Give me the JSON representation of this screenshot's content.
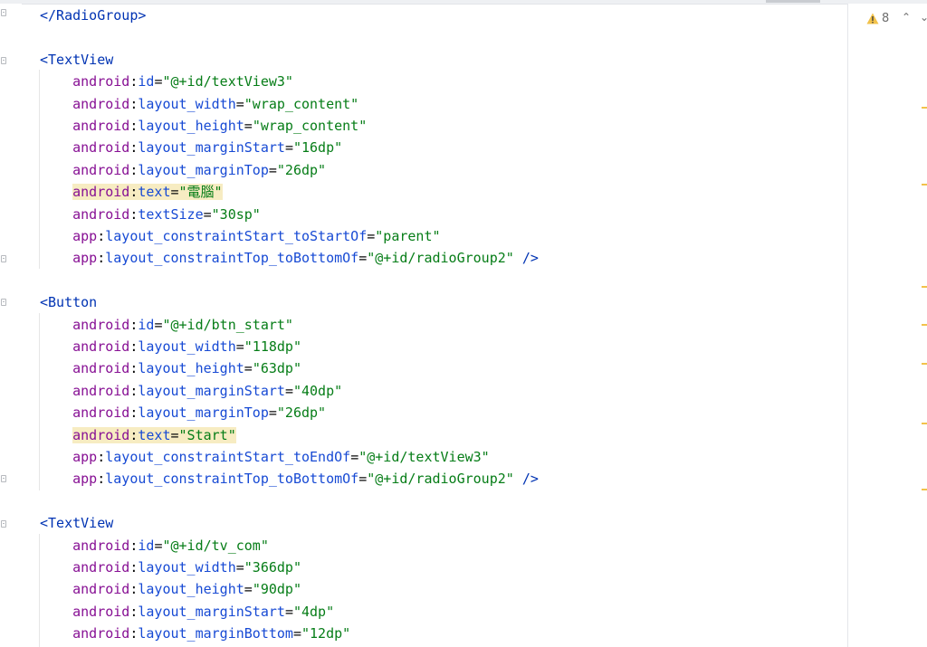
{
  "editor": {
    "lines": [
      {
        "indent": "",
        "parts": [
          [
            "tag",
            "</RadioGroup>"
          ]
        ]
      },
      {
        "indent": "",
        "parts": []
      },
      {
        "indent": "",
        "parts": [
          [
            "tag",
            "<TextView"
          ]
        ]
      },
      {
        "indent": "    ",
        "parts": [
          [
            "ns",
            "android"
          ],
          [
            "plain",
            ":"
          ],
          [
            "attr",
            "id"
          ],
          [
            "plain",
            "="
          ],
          [
            "val",
            "\"@+id/textView3\""
          ]
        ]
      },
      {
        "indent": "    ",
        "parts": [
          [
            "ns",
            "android"
          ],
          [
            "plain",
            ":"
          ],
          [
            "attr",
            "layout_width"
          ],
          [
            "plain",
            "="
          ],
          [
            "val",
            "\"wrap_content\""
          ]
        ]
      },
      {
        "indent": "    ",
        "parts": [
          [
            "ns",
            "android"
          ],
          [
            "plain",
            ":"
          ],
          [
            "attr",
            "layout_height"
          ],
          [
            "plain",
            "="
          ],
          [
            "val",
            "\"wrap_content\""
          ]
        ]
      },
      {
        "indent": "    ",
        "parts": [
          [
            "ns",
            "android"
          ],
          [
            "plain",
            ":"
          ],
          [
            "attr",
            "layout_marginStart"
          ],
          [
            "plain",
            "="
          ],
          [
            "val",
            "\"16dp\""
          ]
        ]
      },
      {
        "indent": "    ",
        "parts": [
          [
            "ns",
            "android"
          ],
          [
            "plain",
            ":"
          ],
          [
            "attr",
            "layout_marginTop"
          ],
          [
            "plain",
            "="
          ],
          [
            "val",
            "\"26dp\""
          ]
        ]
      },
      {
        "indent": "    ",
        "highlight": true,
        "parts": [
          [
            "ns",
            "android"
          ],
          [
            "plain",
            ":"
          ],
          [
            "attr",
            "text"
          ],
          [
            "plain",
            "="
          ],
          [
            "val",
            "\"電腦\""
          ]
        ]
      },
      {
        "indent": "    ",
        "parts": [
          [
            "ns",
            "android"
          ],
          [
            "plain",
            ":"
          ],
          [
            "attr",
            "textSize"
          ],
          [
            "plain",
            "="
          ],
          [
            "val",
            "\"30sp\""
          ]
        ]
      },
      {
        "indent": "    ",
        "parts": [
          [
            "ns",
            "app"
          ],
          [
            "plain",
            ":"
          ],
          [
            "attr",
            "layout_constraintStart_toStartOf"
          ],
          [
            "plain",
            "="
          ],
          [
            "val",
            "\"parent\""
          ]
        ]
      },
      {
        "indent": "    ",
        "parts": [
          [
            "ns",
            "app"
          ],
          [
            "plain",
            ":"
          ],
          [
            "attr",
            "layout_constraintTop_toBottomOf"
          ],
          [
            "plain",
            "="
          ],
          [
            "val",
            "\"@+id/radioGroup2\""
          ],
          [
            "plain",
            " "
          ],
          [
            "tag",
            "/>"
          ]
        ]
      },
      {
        "indent": "",
        "parts": []
      },
      {
        "indent": "",
        "parts": [
          [
            "tag",
            "<Button"
          ]
        ]
      },
      {
        "indent": "    ",
        "parts": [
          [
            "ns",
            "android"
          ],
          [
            "plain",
            ":"
          ],
          [
            "attr",
            "id"
          ],
          [
            "plain",
            "="
          ],
          [
            "val",
            "\"@+id/btn_start\""
          ]
        ]
      },
      {
        "indent": "    ",
        "parts": [
          [
            "ns",
            "android"
          ],
          [
            "plain",
            ":"
          ],
          [
            "attr",
            "layout_width"
          ],
          [
            "plain",
            "="
          ],
          [
            "val",
            "\"118dp\""
          ]
        ]
      },
      {
        "indent": "    ",
        "parts": [
          [
            "ns",
            "android"
          ],
          [
            "plain",
            ":"
          ],
          [
            "attr",
            "layout_height"
          ],
          [
            "plain",
            "="
          ],
          [
            "val",
            "\"63dp\""
          ]
        ]
      },
      {
        "indent": "    ",
        "parts": [
          [
            "ns",
            "android"
          ],
          [
            "plain",
            ":"
          ],
          [
            "attr",
            "layout_marginStart"
          ],
          [
            "plain",
            "="
          ],
          [
            "val",
            "\"40dp\""
          ]
        ]
      },
      {
        "indent": "    ",
        "parts": [
          [
            "ns",
            "android"
          ],
          [
            "plain",
            ":"
          ],
          [
            "attr",
            "layout_marginTop"
          ],
          [
            "plain",
            "="
          ],
          [
            "val",
            "\"26dp\""
          ]
        ]
      },
      {
        "indent": "    ",
        "highlight": true,
        "parts": [
          [
            "ns",
            "android"
          ],
          [
            "plain",
            ":"
          ],
          [
            "attr",
            "text"
          ],
          [
            "plain",
            "="
          ],
          [
            "val",
            "\"Start\""
          ]
        ]
      },
      {
        "indent": "    ",
        "parts": [
          [
            "ns",
            "app"
          ],
          [
            "plain",
            ":"
          ],
          [
            "attr",
            "layout_constraintStart_toEndOf"
          ],
          [
            "plain",
            "="
          ],
          [
            "val",
            "\"@+id/textView3\""
          ]
        ]
      },
      {
        "indent": "    ",
        "parts": [
          [
            "ns",
            "app"
          ],
          [
            "plain",
            ":"
          ],
          [
            "attr",
            "layout_constraintTop_toBottomOf"
          ],
          [
            "plain",
            "="
          ],
          [
            "val",
            "\"@+id/radioGroup2\""
          ],
          [
            "plain",
            " "
          ],
          [
            "tag",
            "/>"
          ]
        ]
      },
      {
        "indent": "",
        "parts": []
      },
      {
        "indent": "",
        "parts": [
          [
            "tag",
            "<TextView"
          ]
        ]
      },
      {
        "indent": "    ",
        "parts": [
          [
            "ns",
            "android"
          ],
          [
            "plain",
            ":"
          ],
          [
            "attr",
            "id"
          ],
          [
            "plain",
            "="
          ],
          [
            "val",
            "\"@+id/tv_com\""
          ]
        ]
      },
      {
        "indent": "    ",
        "parts": [
          [
            "ns",
            "android"
          ],
          [
            "plain",
            ":"
          ],
          [
            "attr",
            "layout_width"
          ],
          [
            "plain",
            "="
          ],
          [
            "val",
            "\"366dp\""
          ]
        ]
      },
      {
        "indent": "    ",
        "parts": [
          [
            "ns",
            "android"
          ],
          [
            "plain",
            ":"
          ],
          [
            "attr",
            "layout_height"
          ],
          [
            "plain",
            "="
          ],
          [
            "val",
            "\"90dp\""
          ]
        ]
      },
      {
        "indent": "    ",
        "parts": [
          [
            "ns",
            "android"
          ],
          [
            "plain",
            ":"
          ],
          [
            "attr",
            "layout_marginStart"
          ],
          [
            "plain",
            "="
          ],
          [
            "val",
            "\"4dp\""
          ]
        ]
      },
      {
        "indent": "    ",
        "parts": [
          [
            "ns",
            "android"
          ],
          [
            "plain",
            ":"
          ],
          [
            "attr",
            "layout_marginBottom"
          ],
          [
            "plain",
            "="
          ],
          [
            "val",
            "\"12dp\""
          ]
        ]
      }
    ]
  },
  "inspections": {
    "icon": "warning-icon",
    "warning_count": "8",
    "prev_icon": "chevron-up-icon",
    "next_icon": "chevron-down-icon"
  },
  "colors": {
    "tag": "#0033b3",
    "namespace": "#871094",
    "attribute": "#174ad4",
    "value": "#067d17",
    "highlight": "#f7ecc2",
    "warning": "#f2c24a"
  }
}
